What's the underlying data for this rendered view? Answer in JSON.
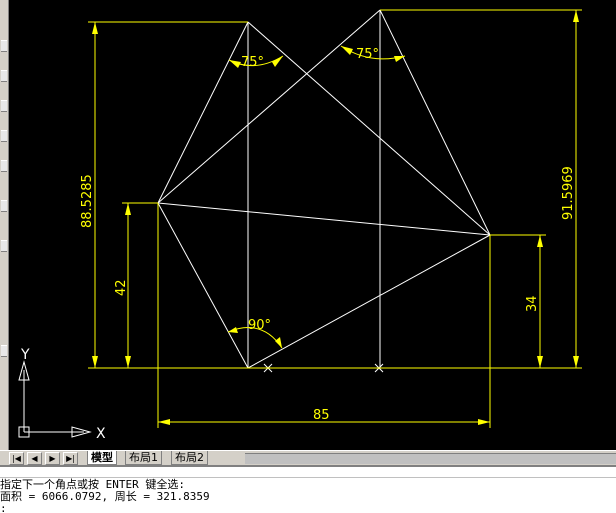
{
  "drawing": {
    "angles": [
      "75°",
      "75°",
      "90°"
    ],
    "dimensions": {
      "left_total": "88.5285",
      "left_inner": "42",
      "right_total": "91.5969",
      "right_inner": "34",
      "bottom": "85"
    },
    "ucs": {
      "x_label": "X",
      "y_label": "Y"
    },
    "colors": {
      "background": "#000000",
      "geometry": "#ffffff",
      "dimension": "#ffff00"
    }
  },
  "tabs": {
    "model": "模型",
    "layout1": "布局1",
    "layout2": "布局2"
  },
  "nav": {
    "first": "|◀",
    "prev": "◀",
    "next": "▶",
    "last": "▶|"
  },
  "command": {
    "prompt": "指定下一个角点或按 ENTER 键全选:",
    "result": "面积 = 6066.0792, 周长 = 321.8359",
    "cursor": ":"
  }
}
